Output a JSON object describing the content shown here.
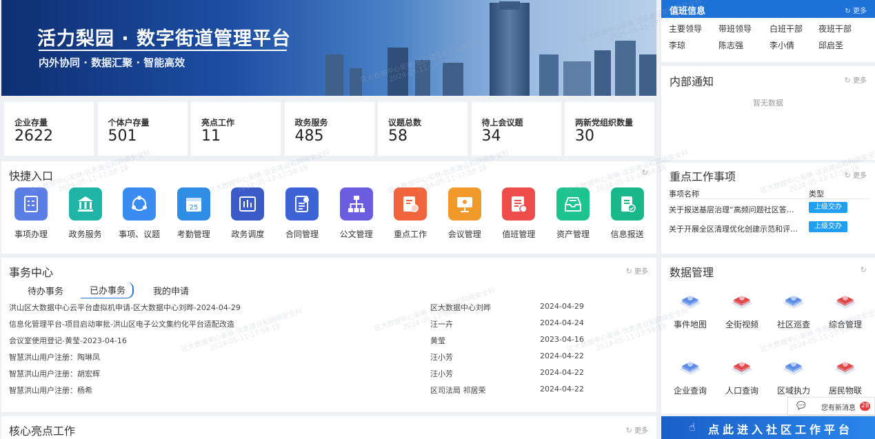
{
  "banner": {
    "title": "活力梨园 · 数字街道管理平台",
    "subtitle": "内外协同 · 数据汇聚 · 智能高效"
  },
  "stats": [
    {
      "label": "企业存量",
      "value": "2622"
    },
    {
      "label": "个体户存量",
      "value": "501"
    },
    {
      "label": "亮点工作",
      "value": "11"
    },
    {
      "label": "政务服务",
      "value": "485"
    },
    {
      "label": "议题总数",
      "value": "58"
    },
    {
      "label": "待上会议题",
      "value": "34"
    },
    {
      "label": "两新党组织数量",
      "value": "30"
    }
  ],
  "quick": {
    "title": "快捷入口",
    "items": [
      {
        "label": "事项办理",
        "color": "#5b7ee6",
        "icon": "checklist-icon"
      },
      {
        "label": "政务服务",
        "color": "#1fb5a6",
        "icon": "government-building-icon"
      },
      {
        "label": "事项、议题",
        "color": "#3b8cf0",
        "icon": "workflow-cycle-icon"
      },
      {
        "label": "考勤管理",
        "color": "#2f8de6",
        "icon": "calendar-icon"
      },
      {
        "label": "政务调度",
        "color": "#3b5cc8",
        "icon": "schedule-dispatch-icon"
      },
      {
        "label": "合同管理",
        "color": "#3d63d6",
        "icon": "contract-document-icon"
      },
      {
        "label": "公文管理",
        "color": "#6b5de0",
        "icon": "org-chart-icon"
      },
      {
        "label": "重点工作",
        "color": "#f0643c",
        "icon": "award-document-icon"
      },
      {
        "label": "会议管理",
        "color": "#f09a2c",
        "icon": "presentation-icon"
      },
      {
        "label": "值班管理",
        "color": "#ee4b4b",
        "icon": "duty-roster-icon"
      },
      {
        "label": "资产管理",
        "color": "#1ec48e",
        "icon": "inbox-tray-icon"
      },
      {
        "label": "信息报送",
        "color": "#19b88a",
        "icon": "report-submit-icon"
      }
    ]
  },
  "affairs": {
    "title": "事务中心",
    "more": "更多",
    "tabs": [
      "待办事务",
      "已办事务",
      "我的申请"
    ],
    "rows": [
      {
        "name": "洪山区大数据中心云平台虚拟机申请-区大数据中心刘晔-2024-04-29",
        "person": "区大数据中心刘晔",
        "date": "2024-04-29"
      },
      {
        "name": "信息化管理平台-项目启动审批-洪山区电子公文集约化平台适配改造",
        "person": "汪一卉",
        "date": "2024-04-24"
      },
      {
        "name": "会议室使用登记-黄莹-2023-04-16",
        "person": "黄莹",
        "date": "2023-04-16"
      },
      {
        "name": "智慧洪山用户注册：陶琳凤",
        "person": "汪小芳",
        "date": "2024-04-22"
      },
      {
        "name": "智慧洪山用户注册：胡宏辉",
        "person": "汪小芳",
        "date": "2024-04-22"
      },
      {
        "name": "智慧洪山用户注册：杨希",
        "person": "区司法局 祁居荣",
        "date": "2024-04-22"
      }
    ]
  },
  "core": {
    "title": "核心亮点工作",
    "more": "更多"
  },
  "duty": {
    "title": "值班信息",
    "more": "更多",
    "headers": [
      "主要领导",
      "带班领导",
      "白班干部",
      "夜班干部"
    ],
    "names": [
      "李琼",
      "陈志强",
      "李小倩",
      "邱启圣"
    ]
  },
  "notice": {
    "title": "内部通知",
    "more": "更多",
    "empty": "暂无数据"
  },
  "keywork": {
    "title": "重点工作事项",
    "more": "更多",
    "col1": "事项名称",
    "col2": "类型",
    "rows": [
      {
        "name": "关于报送基层治理“高频问题社区答…",
        "type": "上级交办"
      },
      {
        "name": "关于开展全区清理优化创建示范和评…",
        "type": "上级交办"
      }
    ]
  },
  "datamgmt": {
    "title": "数据管理",
    "items": [
      {
        "label": "事件地图",
        "color": "#5b8ce8"
      },
      {
        "label": "全街视频",
        "color": "#e04848"
      },
      {
        "label": "社区巡查",
        "color": "#5b8ce8"
      },
      {
        "label": "综合管理",
        "color": "#e04848"
      },
      {
        "label": "企业查询",
        "color": "#5b8ce8"
      },
      {
        "label": "人口查询",
        "color": "#e04848"
      },
      {
        "label": "区域执力",
        "color": "#5b8ce8"
      },
      {
        "label": "居民物联",
        "color": "#e04848"
      }
    ]
  },
  "message": {
    "text": "您有新消息",
    "count": "28"
  },
  "community": {
    "label": "点此进入社区工作平台"
  },
  "watermark": {
    "text": "区大数据中心吴琳-信息建设和网络安全科",
    "date": "2024-05-11-17:58:18"
  },
  "colors": {
    "primary": "#1f73d8",
    "badge": "#1f9ef2",
    "bg": "#eef0f4"
  }
}
